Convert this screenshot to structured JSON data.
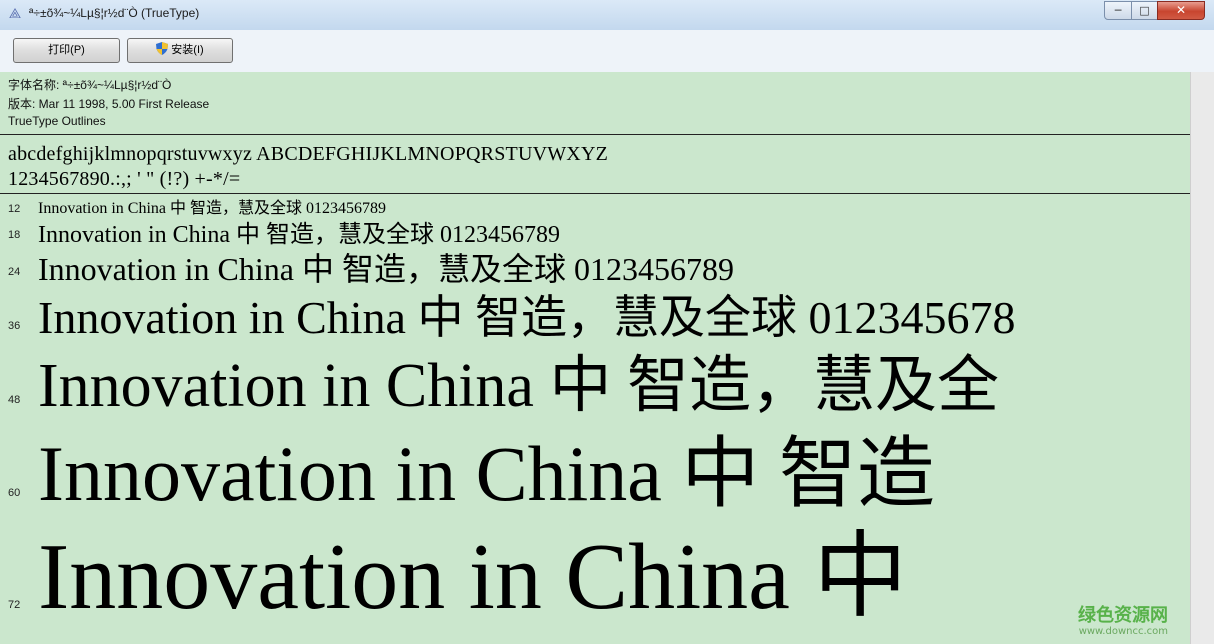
{
  "window": {
    "title": "ª÷±õ¾~¼Lµ§¦r½d¨Ò (TrueType)",
    "icon": "font-viewer-icon",
    "minimize_glyph": "─",
    "maximize_glyph": "□",
    "close_glyph": "✕"
  },
  "toolbar": {
    "print_label": "打印(P)",
    "install_label": "安装(I)"
  },
  "info": {
    "font_name_line": "字体名称: ª÷±õ¾~¼Lµ§¦r½d¨Ò",
    "version_line": "版本: Mar 11 1998, 5.00 First Release",
    "outline_line": "TrueType Outlines"
  },
  "charset": {
    "letters": "abcdefghijklmnopqrstuvwxyz ABCDEFGHIJKLMNOPQRSTUVWXYZ",
    "digits": "1234567890.:,; ' \" (!?) +-*/="
  },
  "samples": [
    {
      "size": "12",
      "text": "Innovation in China 中  智造，慧及全球 0123456789"
    },
    {
      "size": "18",
      "text": "Innovation in China 中  智造，慧及全球 0123456789"
    },
    {
      "size": "24",
      "text": "Innovation in China 中  智造，慧及全球 0123456789"
    },
    {
      "size": "36",
      "text": "Innovation in China 中  智造，慧及全球 012345678"
    },
    {
      "size": "48",
      "text": "Innovation in China 中  智造，慧及全"
    },
    {
      "size": "60",
      "text": "Innovation in China 中  智造"
    },
    {
      "size": "72",
      "text": "Innovation in China 中"
    }
  ],
  "watermark": {
    "main": "绿色资源网",
    "sub": "www.downcc.com"
  },
  "colors": {
    "content_bg": "#cbe7cd",
    "watermark": "#58b24a"
  }
}
